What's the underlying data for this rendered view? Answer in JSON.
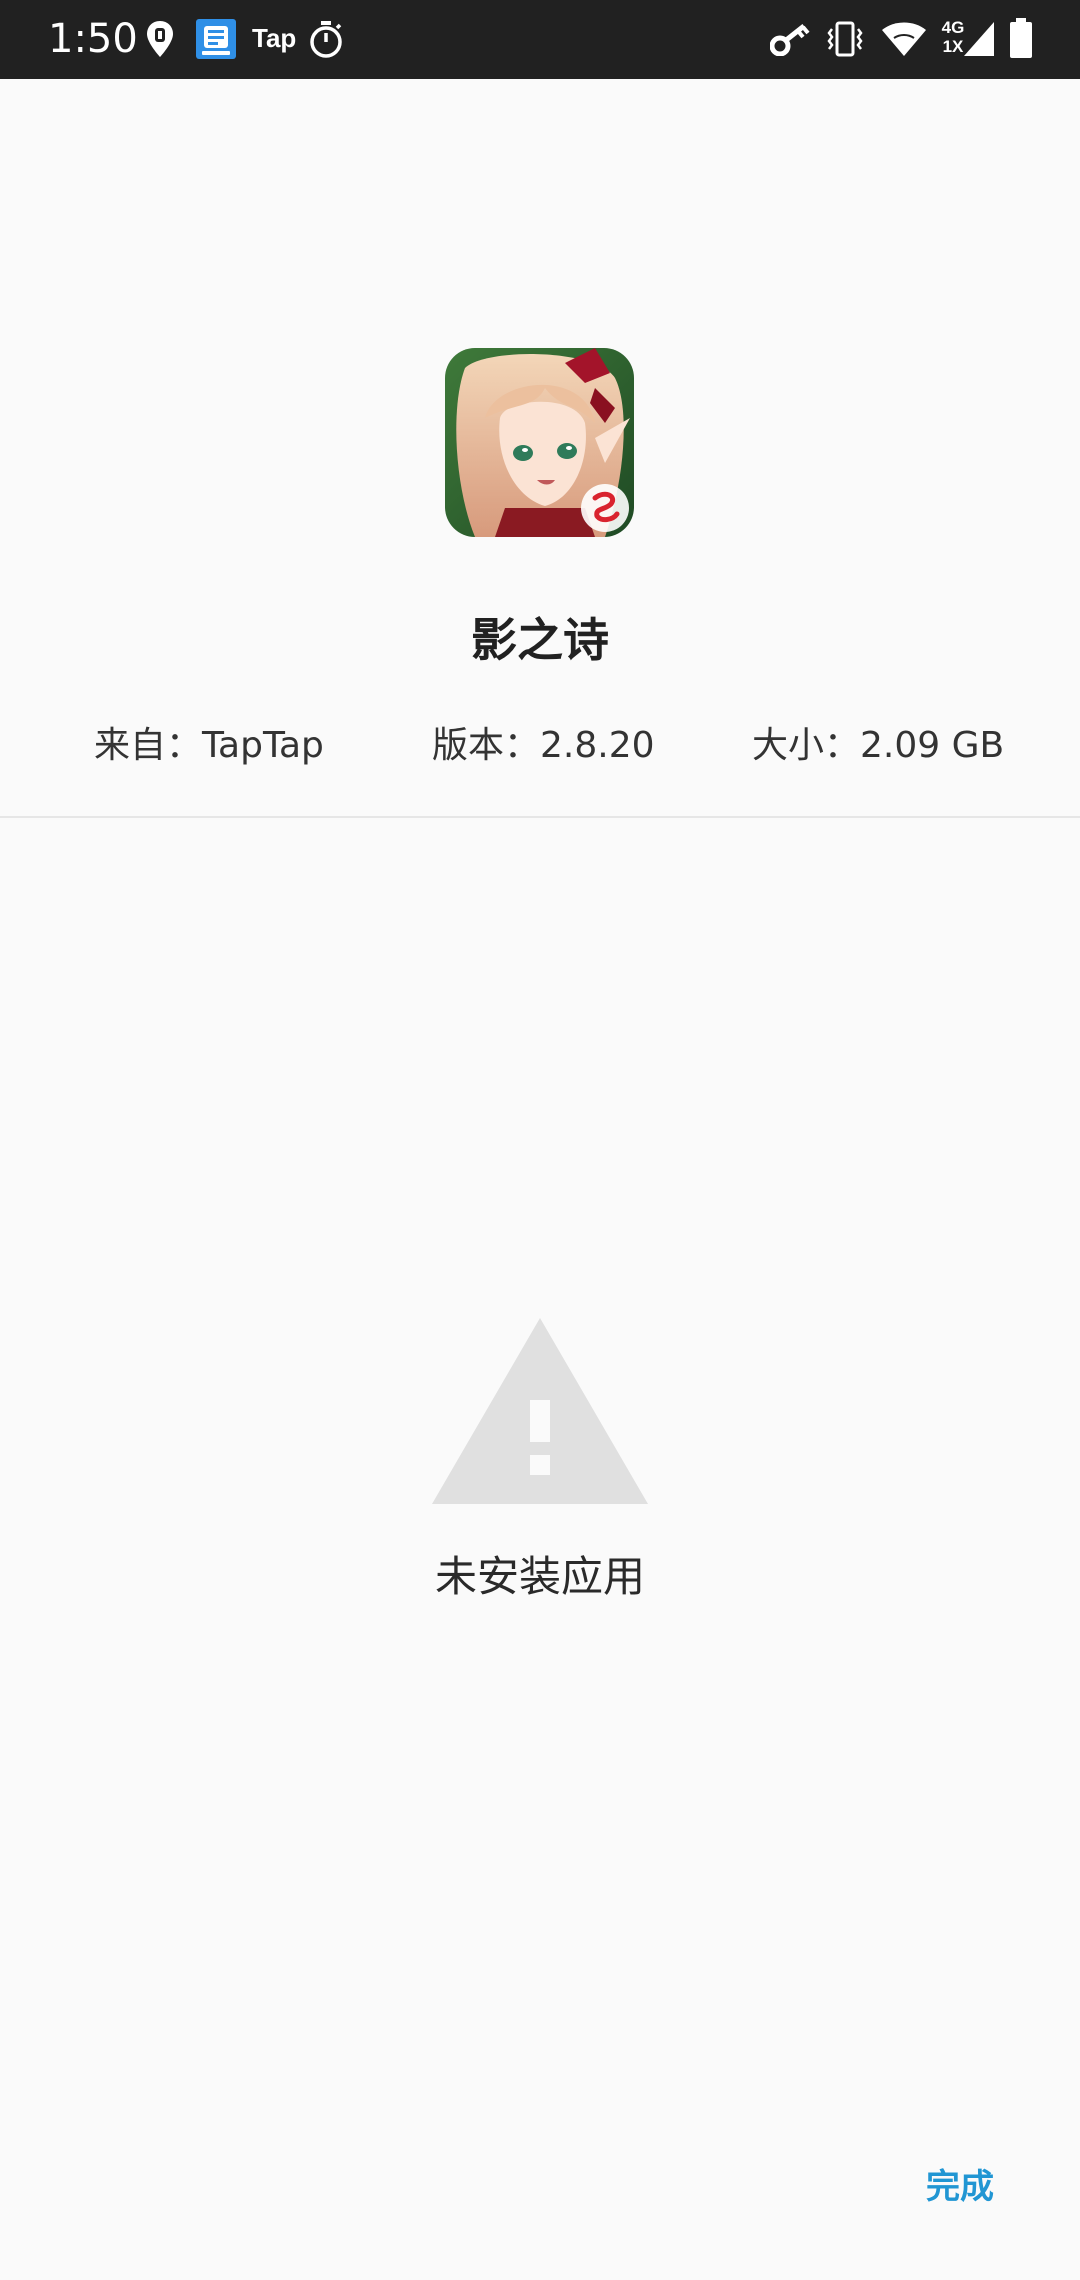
{
  "status_bar": {
    "time": "1:50",
    "tap_label": "Tap",
    "network_type": "4G",
    "sim_slot": "1X",
    "icons": [
      "location-pin-icon",
      "app-notification-icon",
      "timer-icon",
      "vpn-key-icon",
      "vibrate-icon",
      "wifi-icon",
      "cellular-signal-icon",
      "battery-icon"
    ]
  },
  "app": {
    "name": "影之诗",
    "icon": "app-icon-anime-elf",
    "source_label": "来自：TapTap",
    "version_label": "版本：2.8.20",
    "size_label": "大小：2.09 GB"
  },
  "result": {
    "icon": "warning-icon",
    "message": "未安装应用"
  },
  "actions": {
    "done_label": "完成",
    "accent_color": "#2196d3"
  }
}
